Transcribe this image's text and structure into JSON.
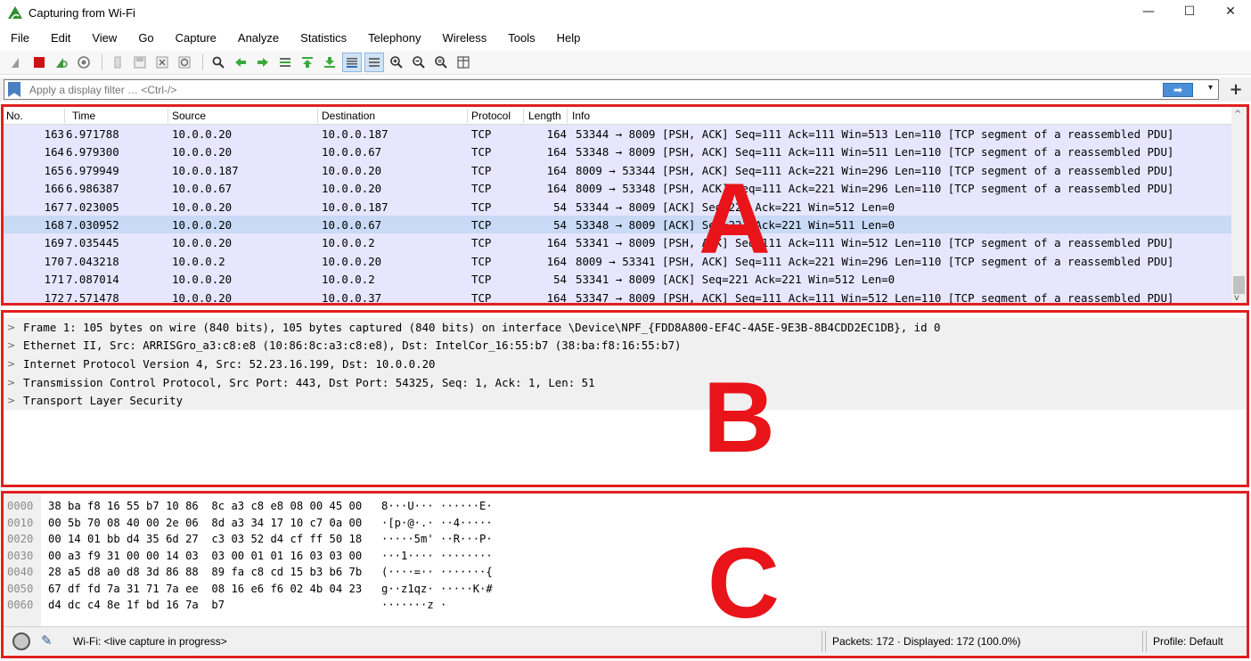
{
  "window": {
    "title": "Capturing from Wi-Fi",
    "controls": {
      "minimize": "—",
      "maximize": "☐",
      "close": "✕"
    }
  },
  "menu": [
    "File",
    "Edit",
    "View",
    "Go",
    "Capture",
    "Analyze",
    "Statistics",
    "Telephony",
    "Wireless",
    "Tools",
    "Help"
  ],
  "toolbar_icons": [
    "shark-fin-icon",
    "stop-capture-icon",
    "restart-capture-icon",
    "capture-options-icon",
    "open-file-icon",
    "save-file-icon",
    "close-file-icon",
    "reload-icon",
    "find-packet-icon",
    "go-back-icon",
    "go-forward-icon",
    "go-to-packet-icon",
    "first-packet-icon",
    "last-packet-icon",
    "autoscroll-icon",
    "colorize-icon",
    "zoom-in-icon",
    "zoom-out-icon",
    "normal-size-icon",
    "resize-columns-icon"
  ],
  "filter": {
    "placeholder": "Apply a display filter … <Ctrl-/>",
    "apply_label": "➡",
    "dropdown": "▾",
    "add": "+"
  },
  "packet_list": {
    "columns": [
      "No.",
      "Time",
      "Source",
      "Destination",
      "Protocol",
      "Length",
      "Info"
    ],
    "rows": [
      {
        "no": "163",
        "time": "6.971788",
        "src": "10.0.0.20",
        "dst": "10.0.0.187",
        "proto": "TCP",
        "len": "164",
        "info": "53344 → 8009 [PSH, ACK] Seq=111 Ack=111 Win=513 Len=110 [TCP segment of a reassembled PDU]"
      },
      {
        "no": "164",
        "time": "6.979300",
        "src": "10.0.0.20",
        "dst": "10.0.0.67",
        "proto": "TCP",
        "len": "164",
        "info": "53348 → 8009 [PSH, ACK] Seq=111 Ack=111 Win=511 Len=110 [TCP segment of a reassembled PDU]"
      },
      {
        "no": "165",
        "time": "6.979949",
        "src": "10.0.0.187",
        "dst": "10.0.0.20",
        "proto": "TCP",
        "len": "164",
        "info": "8009 → 53344 [PSH, ACK] Seq=111 Ack=221 Win=296 Len=110 [TCP segment of a reassembled PDU]"
      },
      {
        "no": "166",
        "time": "6.986387",
        "src": "10.0.0.67",
        "dst": "10.0.0.20",
        "proto": "TCP",
        "len": "164",
        "info": "8009 → 53348 [PSH, ACK] Seq=111 Ack=221 Win=296 Len=110 [TCP segment of a reassembled PDU]"
      },
      {
        "no": "167",
        "time": "7.023005",
        "src": "10.0.0.20",
        "dst": "10.0.0.187",
        "proto": "TCP",
        "len": "54",
        "info": "53344 → 8009 [ACK] Seq=221 Ack=221 Win=512 Len=0"
      },
      {
        "no": "168",
        "time": "7.030952",
        "src": "10.0.0.20",
        "dst": "10.0.0.67",
        "proto": "TCP",
        "len": "54",
        "info": "53348 → 8009 [ACK] Seq=221 Ack=221 Win=511 Len=0"
      },
      {
        "no": "169",
        "time": "7.035445",
        "src": "10.0.0.20",
        "dst": "10.0.0.2",
        "proto": "TCP",
        "len": "164",
        "info": "53341 → 8009 [PSH, ACK] Seq=111 Ack=111 Win=512 Len=110 [TCP segment of a reassembled PDU]"
      },
      {
        "no": "170",
        "time": "7.043218",
        "src": "10.0.0.2",
        "dst": "10.0.0.20",
        "proto": "TCP",
        "len": "164",
        "info": "8009 → 53341 [PSH, ACK] Seq=111 Ack=221 Win=296 Len=110 [TCP segment of a reassembled PDU]"
      },
      {
        "no": "171",
        "time": "7.087014",
        "src": "10.0.0.20",
        "dst": "10.0.0.2",
        "proto": "TCP",
        "len": "54",
        "info": "53341 → 8009 [ACK] Seq=221 Ack=221 Win=512 Len=0"
      },
      {
        "no": "172",
        "time": "7.571478",
        "src": "10.0.0.20",
        "dst": "10.0.0.37",
        "proto": "TCP",
        "len": "164",
        "info": "53347 → 8009 [PSH, ACK] Seq=111 Ack=111 Win=512 Len=110 [TCP segment of a reassembled PDU]"
      }
    ],
    "selected_no": "168",
    "scroll_up": "^",
    "scroll_down": "v"
  },
  "packet_details": {
    "expander": ">",
    "rows": [
      "Frame 1: 105 bytes on wire (840 bits), 105 bytes captured (840 bits) on interface \\Device\\NPF_{FDD8A800-EF4C-4A5E-9E3B-8B4CDD2EC1DB}, id 0",
      "Ethernet II, Src: ARRISGro_a3:c8:e8 (10:86:8c:a3:c8:e8), Dst: IntelCor_16:55:b7 (38:ba:f8:16:55:b7)",
      "Internet Protocol Version 4, Src: 52.23.16.199, Dst: 10.0.0.20",
      "Transmission Control Protocol, Src Port: 443, Dst Port: 54325, Seq: 1, Ack: 1, Len: 51",
      "Transport Layer Security"
    ]
  },
  "packet_bytes": {
    "rows": [
      {
        "offset": "0000",
        "hex": "38 ba f8 16 55 b7 10 86  8c a3 c8 e8 08 00 45 00",
        "ascii": "8···U··· ······E·"
      },
      {
        "offset": "0010",
        "hex": "00 5b 70 08 40 00 2e 06  8d a3 34 17 10 c7 0a 00",
        "ascii": "·[p·@·.· ··4·····"
      },
      {
        "offset": "0020",
        "hex": "00 14 01 bb d4 35 6d 27  c3 03 52 d4 cf ff 50 18",
        "ascii": "·····5m' ··R···P·"
      },
      {
        "offset": "0030",
        "hex": "00 a3 f9 31 00 00 14 03  03 00 01 01 16 03 03 00",
        "ascii": "···1···· ········"
      },
      {
        "offset": "0040",
        "hex": "28 a5 d8 a0 d8 3d 86 88  89 fa c8 cd 15 b3 b6 7b",
        "ascii": "(····=·· ·······{"
      },
      {
        "offset": "0050",
        "hex": "67 df fd 7a 31 71 7a ee  08 16 e6 f6 02 4b 04 23",
        "ascii": "g··z1qz· ·····K·#"
      },
      {
        "offset": "0060",
        "hex": "d4 dc c4 8e 1f bd 16 7a  b7",
        "ascii": "·······z ·"
      }
    ]
  },
  "status": {
    "capture": "Wi-Fi: <live capture in progress>",
    "packets": "Packets: 172 · Displayed: 172 (100.0%)",
    "profile": "Profile: Default"
  },
  "annotations": {
    "a": "A",
    "b": "B",
    "c": "C"
  },
  "colors": {
    "annotation": "#e8141a",
    "row_tcp": "#e7e6ff",
    "row_selected": "#c8daf5"
  }
}
